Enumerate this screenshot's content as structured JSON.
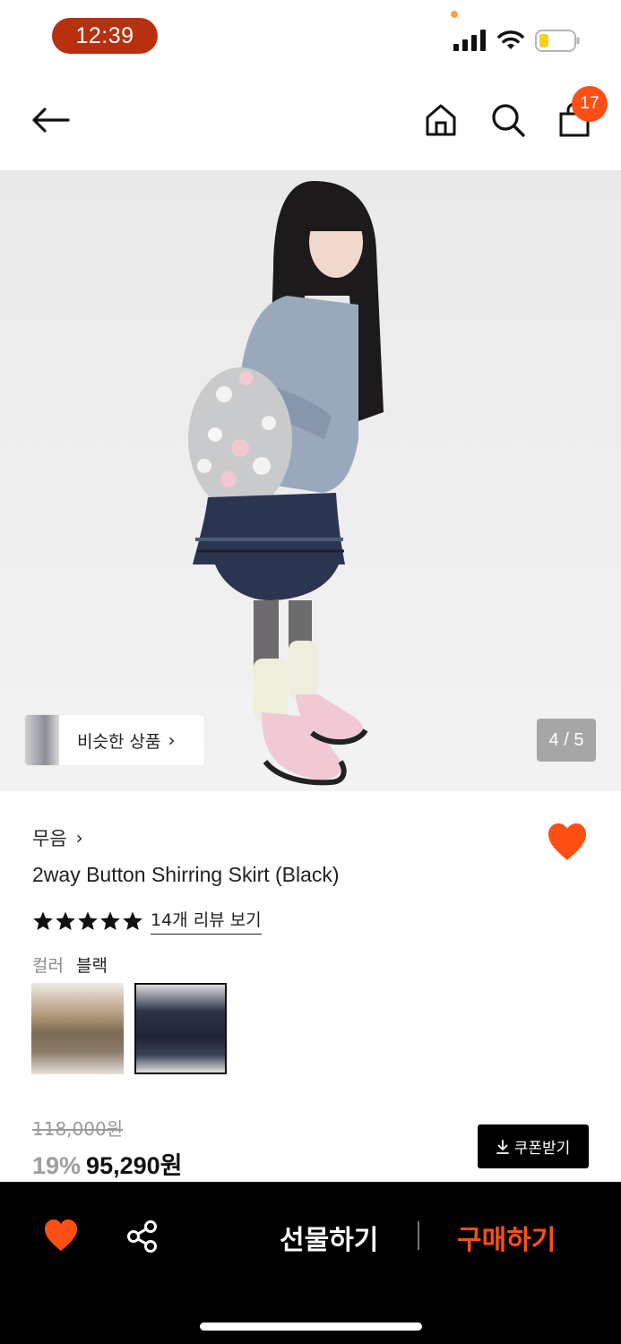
{
  "status_bar": {
    "time": "12:39",
    "accent_color": "#b8300f"
  },
  "header": {
    "back_icon": "arrow-left-icon",
    "home_icon": "home-icon",
    "search_icon": "search-icon",
    "cart_icon": "shopping-bag-icon",
    "cart_count": "17",
    "badge_color": "#ff4f14"
  },
  "gallery": {
    "similar_label": "비슷한 상품",
    "similar_chevron": "›",
    "page_counter": "4 / 5",
    "current_page": 4,
    "total_pages": 5
  },
  "product": {
    "brand": "무음",
    "brand_chevron": "›",
    "title": "2way Button Shirring Skirt (Black)",
    "rating_stars": 5,
    "review_link": "14개 리뷰 보기",
    "color_label": "컬러",
    "color_value": "블랙",
    "wished": true,
    "heart_color": "#ff4f14"
  },
  "price": {
    "original": "118,000원",
    "discount": "19%",
    "sale": "95,290원",
    "coupon_label": "쿠폰받기",
    "coupon_icon": "download-icon"
  },
  "bottom_bar": {
    "heart_icon": "heart-icon",
    "share_icon": "share-icon",
    "gift_label": "선물하기",
    "buy_label": "구매하기",
    "buy_color": "#ff4f14"
  }
}
